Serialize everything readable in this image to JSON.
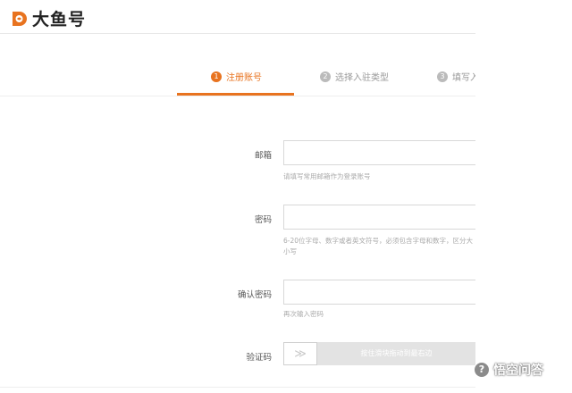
{
  "brand": {
    "name": "大鱼号",
    "color": "#e8731f"
  },
  "steps": [
    {
      "num": "1",
      "label": "注册账号",
      "active": true
    },
    {
      "num": "2",
      "label": "选择入驻类型",
      "active": false
    },
    {
      "num": "3",
      "label": "填写入",
      "active": false
    }
  ],
  "form": {
    "email": {
      "label": "邮箱",
      "value": "",
      "hint": "请填写常用邮箱作为登录账号"
    },
    "password": {
      "label": "密码",
      "value": "",
      "hint": "6-20位字母、数字或者英文符号，必须包含字母和数字，区分大小写"
    },
    "confirm": {
      "label": "确认密码",
      "value": "",
      "hint": "再次输入密码"
    },
    "captcha": {
      "label": "验证码",
      "slider_text": "按住滑块拖动到最右边",
      "handle_glyph": "≫"
    }
  },
  "watermark": {
    "text": "悟空问答",
    "icon": "chat-bubble-icon"
  }
}
